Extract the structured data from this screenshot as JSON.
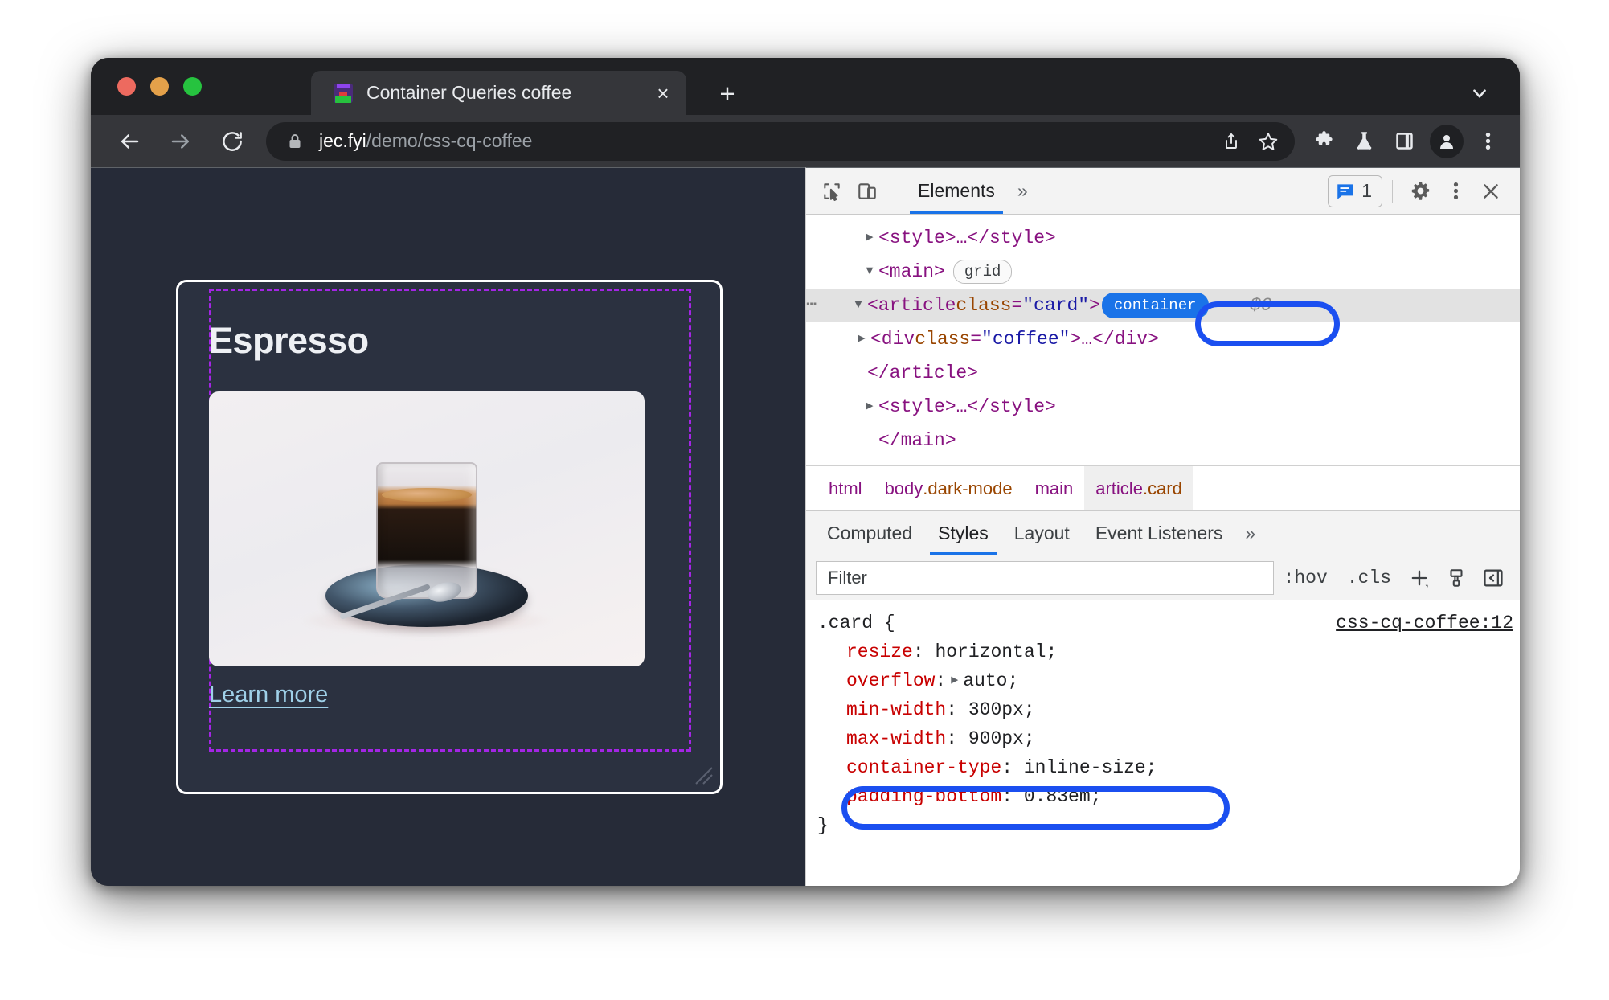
{
  "browser": {
    "tab": {
      "title": "Container Queries coffee",
      "favicon": "coffee-favicon",
      "close_label": "×"
    },
    "new_tab_label": "+",
    "tab_search_icon": "chevron-down-icon",
    "toolbar": {
      "back_icon": "arrow-left-icon",
      "forward_icon": "arrow-right-icon",
      "reload_icon": "reload-icon",
      "lock_icon": "lock-icon",
      "url_host": "jec.fyi",
      "url_path": "/demo/css-cq-coffee",
      "share_icon": "share-icon",
      "bookmark_icon": "star-icon",
      "extensions_icon": "puzzle-icon",
      "labs_icon": "flask-icon",
      "side_panel_icon": "side-panel-icon",
      "profile_icon": "profile-avatar-icon",
      "menu_icon": "kebab-menu-icon"
    }
  },
  "page": {
    "card": {
      "title": "Espresso",
      "image_alt": "espresso-cup-photo",
      "link_text": "Learn more",
      "resize_handle": "resize-handle-icon"
    },
    "colors": {
      "page_background": "#262b38",
      "card_background": "#2b3140",
      "card_border": "#ffffff",
      "container_overlay": "#a425e6",
      "link": "#9fd0e8"
    }
  },
  "devtools": {
    "toolbar": {
      "inspect_icon": "inspect-element-icon",
      "device_toggle_icon": "device-toolbar-icon",
      "active_panel": "Elements",
      "overflow_label": "»",
      "message_icon": "message-icon",
      "message_count": "1",
      "settings_icon": "gear-icon",
      "more_icon": "kebab-menu-icon",
      "close_icon": "close-icon"
    },
    "dom_tree": [
      {
        "id": "style-open",
        "indent": 1,
        "twisty": "▶",
        "selected": false,
        "dots": false,
        "text": "<style>…</style>"
      },
      {
        "id": "main-open",
        "indent": 1,
        "twisty": "▼",
        "selected": false,
        "dots": false,
        "text": "<main>",
        "badge": "grid"
      },
      {
        "id": "article-card",
        "indent": 2,
        "twisty": "▼",
        "selected": true,
        "dots": true,
        "tag_open": "<article ",
        "attr_name": "class",
        "attr_value": "\"card\"",
        "tag_close": ">",
        "badge": "container",
        "eq": "==",
        "dollar": "$0"
      },
      {
        "id": "div-coffee",
        "indent": 3,
        "twisty": "▶",
        "selected": false,
        "dots": false,
        "tag_open": "<div ",
        "attr_name": "class",
        "attr_value": "\"coffee\"",
        "tag_close": ">",
        "ellipsis": "…",
        "closing": "</div>"
      },
      {
        "id": "article-close",
        "indent": 2,
        "twisty": "",
        "selected": false,
        "dots": false,
        "text": "</article>"
      },
      {
        "id": "style-second",
        "indent": 1,
        "twisty": "▶",
        "selected": false,
        "dots": false,
        "text": "<style>…</style>"
      },
      {
        "id": "main-close",
        "indent": 1,
        "twisty": "",
        "selected": false,
        "dots": false,
        "text": "</main>"
      }
    ],
    "breadcrumb": [
      {
        "tag": "html",
        "cls": "",
        "selected": false
      },
      {
        "tag": "body",
        "cls": ".dark-mode",
        "selected": false
      },
      {
        "tag": "main",
        "cls": "",
        "selected": false
      },
      {
        "tag": "article",
        "cls": ".card",
        "selected": true
      }
    ],
    "styles_tabs": [
      {
        "label": "Computed",
        "active": false
      },
      {
        "label": "Styles",
        "active": true
      },
      {
        "label": "Layout",
        "active": false
      },
      {
        "label": "Event Listeners",
        "active": false
      }
    ],
    "styles_tabs_overflow": "»",
    "filter": {
      "placeholder": "Filter",
      "value": "",
      "hov_label": ":hov",
      "cls_label": ".cls",
      "new_rule_icon": "plus-icon",
      "color_picker_icon": "paint-bucket-icon",
      "sidebar_toggle_icon": "sidebar-toggle-icon"
    },
    "css_rule": {
      "selector": ".card {",
      "source": "css-cq-coffee:12",
      "closing_brace": "}",
      "declarations": [
        {
          "property": "resize",
          "value": "horizontal;",
          "has_arrow": false,
          "highlighted": false
        },
        {
          "property": "overflow",
          "value": "auto;",
          "has_arrow": true,
          "highlighted": false
        },
        {
          "property": "min-width",
          "value": "300px;",
          "has_arrow": false,
          "highlighted": false
        },
        {
          "property": "max-width",
          "value": "900px;",
          "has_arrow": false,
          "highlighted": false
        },
        {
          "property": "container-type",
          "value": "inline-size;",
          "has_arrow": false,
          "highlighted": true
        },
        {
          "property": "padding-bottom",
          "value": "0.83em;",
          "has_arrow": false,
          "highlighted": false
        }
      ]
    },
    "colors": {
      "accent": "#1a73e8",
      "annotation": "#1b4ff0",
      "tag": "#881280",
      "attr_name": "#994500",
      "attr_value": "#1a1aa6",
      "property": "#c80000"
    }
  }
}
